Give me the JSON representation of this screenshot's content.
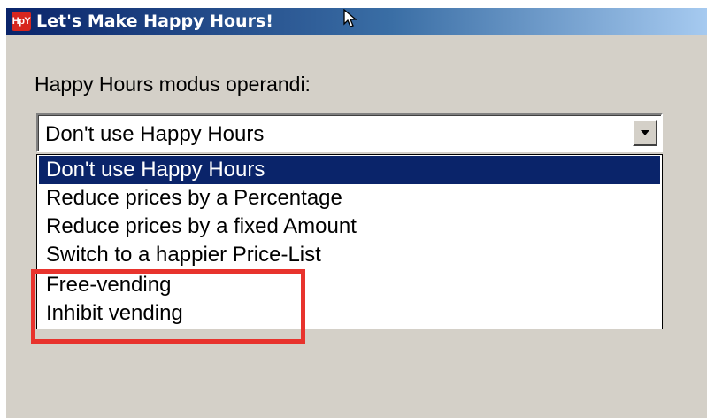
{
  "window": {
    "title": "Let's Make Happy Hours!",
    "app_icon_text": "HpY",
    "background": "#d4d0c8",
    "titlebar_color": "#0a246a"
  },
  "form": {
    "modus_label": "Happy Hours modus operandi:",
    "combo_selected": "Don't use Happy Hours",
    "options": [
      "Don't use Happy Hours",
      "Reduce prices by a Percentage",
      "Reduce prices by a fixed Amount",
      "Switch to a happier Price-List",
      "Free-vending",
      "Inhibit vending"
    ],
    "highlighted_index": 0
  },
  "annotation": {
    "box_color": "#e8332d"
  }
}
